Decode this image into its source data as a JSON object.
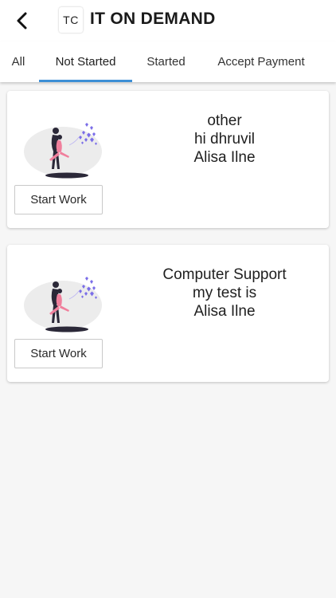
{
  "header": {
    "logo_text": "TC",
    "title": "IT ON DEMAND",
    "back_icon": "chevron-left-icon"
  },
  "tabs": [
    {
      "label": "All",
      "active": false
    },
    {
      "label": "Not Started",
      "active": true
    },
    {
      "label": "Started",
      "active": false
    },
    {
      "label": "Accept Payment",
      "active": false
    }
  ],
  "cards": [
    {
      "category": "other",
      "description": "hi dhruvil",
      "customer": "Alisa Ilne",
      "button_label": "Start Work",
      "illustration": "couple-hearts-illustration"
    },
    {
      "category": "Computer Support",
      "description": "my test is",
      "customer": "Alisa Ilne",
      "button_label": "Start Work",
      "illustration": "couple-hearts-illustration"
    }
  ],
  "colors": {
    "accent": "#3d8fd6",
    "heart": "#7b6ee8",
    "figure_pink": "#f07f9c",
    "background": "#f6f6f6"
  }
}
